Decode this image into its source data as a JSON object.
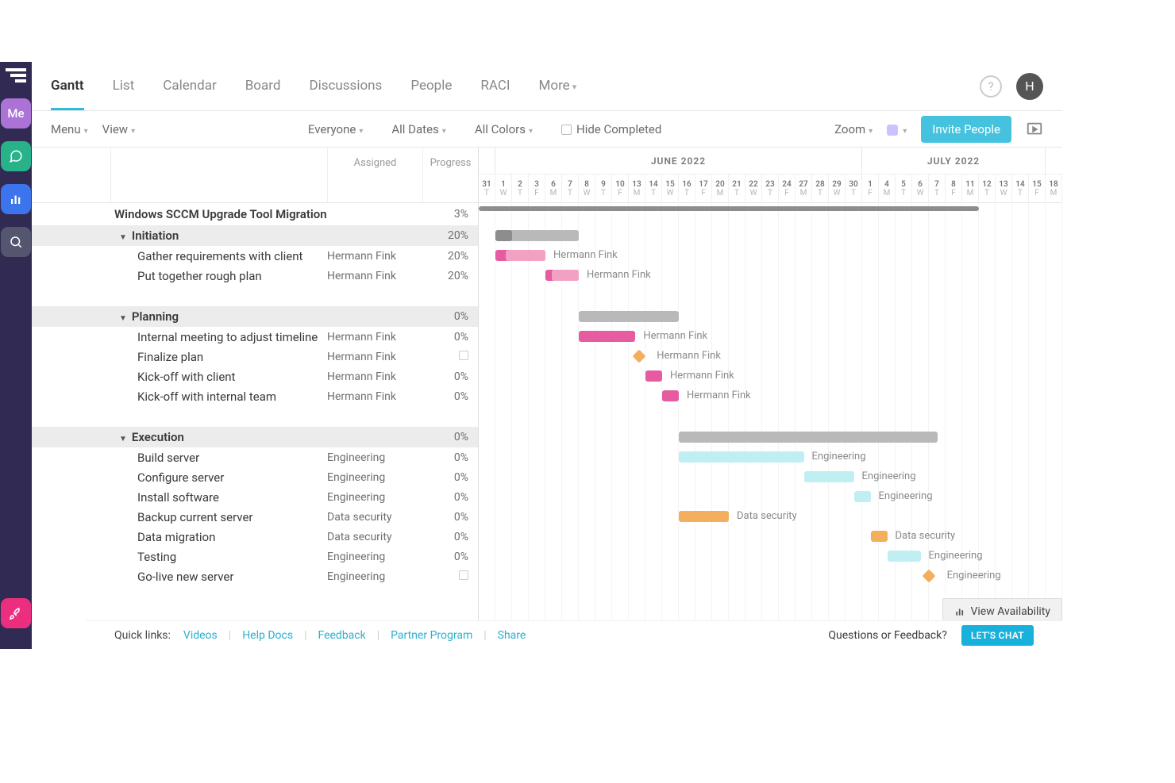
{
  "rail": {
    "me_label": "Me"
  },
  "tabs": [
    "Gantt",
    "List",
    "Calendar",
    "Board",
    "Discussions",
    "People",
    "RACI",
    "More"
  ],
  "active_tab": 0,
  "avatar_initial": "H",
  "filters": {
    "menu": "Menu",
    "view": "View",
    "everyone": "Everyone",
    "all_dates": "All Dates",
    "all_colors": "All Colors",
    "hide_completed": "Hide Completed",
    "zoom": "Zoom",
    "invite": "Invite People"
  },
  "columns": {
    "assigned": "Assigned",
    "progress": "Progress"
  },
  "project_title": "Windows SCCM Upgrade Tool Migration",
  "project_progress": "3%",
  "groups": [
    {
      "name": "Initiation",
      "progress": "20%",
      "bar_start": 1,
      "bar_len": 5,
      "tasks": [
        {
          "name": "Gather requirements with client",
          "assigned": "Hermann Fink",
          "progress": "20%",
          "bar_start": 1,
          "bar_len": 3,
          "color": "pink",
          "label": "Hermann Fink"
        },
        {
          "name": "Put together rough plan",
          "assigned": "Hermann Fink",
          "progress": "20%",
          "bar_start": 4,
          "bar_len": 2,
          "color": "pink",
          "label": "Hermann Fink"
        }
      ]
    },
    {
      "name": "Planning",
      "progress": "0%",
      "bar_start": 6,
      "bar_len": 6,
      "tasks": [
        {
          "name": "Internal meeting to adjust timeline",
          "assigned": "Hermann Fink",
          "progress": "0%",
          "bar_start": 6,
          "bar_len": 3.4,
          "color": "pink",
          "label": "Hermann Fink"
        },
        {
          "name": "Finalize plan",
          "assigned": "Hermann Fink",
          "progress": "",
          "milestone": true,
          "bar_start": 9.6,
          "color": "orange",
          "label": "Hermann Fink"
        },
        {
          "name": "Kick-off with client",
          "assigned": "Hermann Fink",
          "progress": "0%",
          "bar_start": 10,
          "bar_len": 1,
          "color": "pink",
          "label": "Hermann Fink"
        },
        {
          "name": "Kick-off with internal team",
          "assigned": "Hermann Fink",
          "progress": "0%",
          "bar_start": 11,
          "bar_len": 1,
          "color": "pink",
          "label": "Hermann Fink"
        }
      ]
    },
    {
      "name": "Execution",
      "progress": "0%",
      "bar_start": 12,
      "bar_len": 15.5,
      "tasks": [
        {
          "name": "Build server",
          "assigned": "Engineering",
          "progress": "0%",
          "bar_start": 12,
          "bar_len": 7.5,
          "color": "teal",
          "label": "Engineering"
        },
        {
          "name": "Configure server",
          "assigned": "Engineering",
          "progress": "0%",
          "bar_start": 19.5,
          "bar_len": 3,
          "color": "teal",
          "label": "Engineering"
        },
        {
          "name": "Install software",
          "assigned": "Engineering",
          "progress": "0%",
          "bar_start": 22.5,
          "bar_len": 1,
          "color": "teal",
          "label": "Engineering"
        },
        {
          "name": "Backup current server",
          "assigned": "Data security",
          "progress": "0%",
          "bar_start": 12,
          "bar_len": 3,
          "color": "orange",
          "label": "Data security"
        },
        {
          "name": "Data migration",
          "assigned": "Data security",
          "progress": "0%",
          "bar_start": 23.5,
          "bar_len": 1,
          "color": "orange",
          "label": "Data security"
        },
        {
          "name": "Testing",
          "assigned": "Engineering",
          "progress": "0%",
          "bar_start": 24.5,
          "bar_len": 2,
          "color": "teal",
          "label": "Engineering"
        },
        {
          "name": "Go-live new server",
          "assigned": "Engineering",
          "progress": "",
          "milestone": true,
          "bar_start": 27,
          "color": "orange",
          "label": "Engineering"
        }
      ]
    }
  ],
  "timeline": {
    "months": [
      {
        "label": "",
        "span": 1
      },
      {
        "label": "JUNE 2022",
        "span": 22
      },
      {
        "label": "JULY 2022",
        "span": 11
      }
    ],
    "days": [
      {
        "n": "31",
        "w": "T"
      },
      {
        "n": "1",
        "w": "W"
      },
      {
        "n": "2",
        "w": "T"
      },
      {
        "n": "3",
        "w": "F"
      },
      {
        "n": "6",
        "w": "M"
      },
      {
        "n": "7",
        "w": "T"
      },
      {
        "n": "8",
        "w": "W"
      },
      {
        "n": "9",
        "w": "T"
      },
      {
        "n": "10",
        "w": "F"
      },
      {
        "n": "13",
        "w": "M"
      },
      {
        "n": "14",
        "w": "T"
      },
      {
        "n": "15",
        "w": "W"
      },
      {
        "n": "16",
        "w": "T"
      },
      {
        "n": "17",
        "w": "F"
      },
      {
        "n": "20",
        "w": "M"
      },
      {
        "n": "21",
        "w": "T"
      },
      {
        "n": "22",
        "w": "W"
      },
      {
        "n": "23",
        "w": "T"
      },
      {
        "n": "24",
        "w": "F"
      },
      {
        "n": "27",
        "w": "M"
      },
      {
        "n": "28",
        "w": "T"
      },
      {
        "n": "29",
        "w": "W"
      },
      {
        "n": "30",
        "w": "T"
      },
      {
        "n": "1",
        "w": "F"
      },
      {
        "n": "4",
        "w": "M"
      },
      {
        "n": "5",
        "w": "T"
      },
      {
        "n": "6",
        "w": "W"
      },
      {
        "n": "7",
        "w": "T"
      },
      {
        "n": "8",
        "w": "F"
      },
      {
        "n": "11",
        "w": "M"
      },
      {
        "n": "12",
        "w": "T"
      },
      {
        "n": "13",
        "w": "W"
      },
      {
        "n": "14",
        "w": "T"
      },
      {
        "n": "15",
        "w": "F"
      },
      {
        "n": "18",
        "w": "M"
      }
    ]
  },
  "view_availability": "View Availability",
  "footer": {
    "quick_links": "Quick links:",
    "links": [
      "Videos",
      "Help Docs",
      "Feedback",
      "Partner Program",
      "Share"
    ],
    "question": "Questions or Feedback?",
    "chat": "LET'S CHAT"
  }
}
